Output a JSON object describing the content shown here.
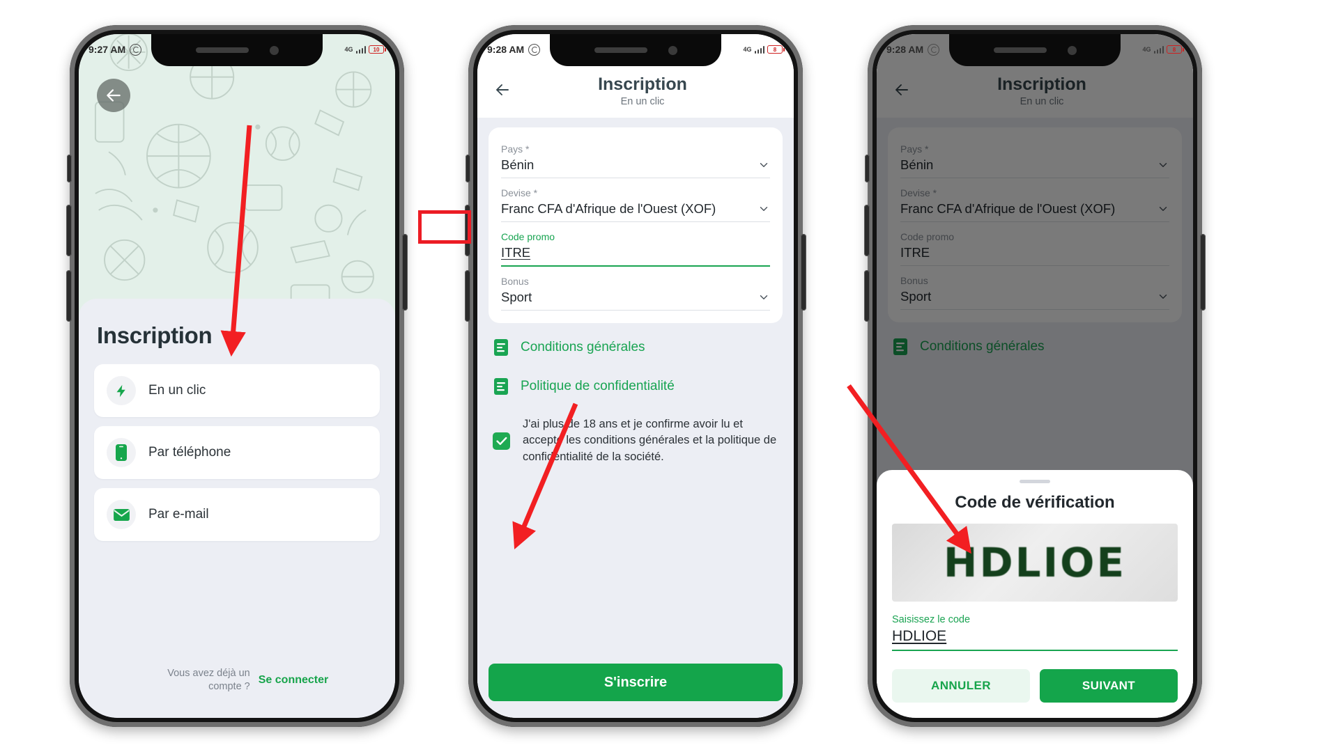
{
  "phones": [
    {
      "id": "phone-registration-methods",
      "statusbar": {
        "time": "9:27 AM",
        "whatsapp_icon": "whatsapp-icon",
        "network": "4G",
        "battery": "10"
      },
      "back_icon": "back-arrow-icon",
      "sheet_title": "Inscription",
      "options": [
        {
          "icon": "lightning-bolt-icon",
          "label": "En un clic"
        },
        {
          "icon": "phone-icon",
          "label": "Par téléphone"
        },
        {
          "icon": "envelope-icon",
          "label": "Par e-mail"
        }
      ],
      "footer": {
        "question": "Vous avez déjà un compte ?",
        "link": "Se connecter"
      }
    },
    {
      "id": "phone-registration-form",
      "statusbar": {
        "time": "9:28 AM",
        "whatsapp_icon": "whatsapp-icon",
        "network": "4G",
        "battery": "8"
      },
      "appbar": {
        "back_icon": "back-arrow-icon",
        "title": "Inscription",
        "subtitle": "En un clic"
      },
      "fields": [
        {
          "label": "Pays *",
          "value": "Bénin",
          "control": "dropdown",
          "focused": false
        },
        {
          "label": "Devise *",
          "value": "Franc CFA d'Afrique de l'Ouest (XOF)",
          "control": "dropdown",
          "focused": false
        },
        {
          "label": "Code promo",
          "value": "ITRE",
          "control": "text",
          "focused": true
        },
        {
          "label": "Bonus",
          "value": "Sport",
          "control": "dropdown",
          "focused": false
        }
      ],
      "links": [
        {
          "icon": "document-icon",
          "label": "Conditions générales"
        },
        {
          "icon": "document-icon",
          "label": "Politique de confidentialité"
        }
      ],
      "consent": {
        "checked": true,
        "text": "J'ai plus de 18 ans et je confirme avoir lu et accepté les conditions générales et la politique de confidentialité de la société."
      },
      "submit_label": "S'inscrire"
    },
    {
      "id": "phone-verification-modal",
      "statusbar": {
        "time": "9:28 AM",
        "whatsapp_icon": "whatsapp-icon",
        "network": "4G",
        "battery": "8"
      },
      "appbar": {
        "back_icon": "back-arrow-icon",
        "title": "Inscription",
        "subtitle": "En un clic"
      },
      "fields": [
        {
          "label": "Pays *",
          "value": "Bénin",
          "control": "dropdown",
          "focused": false
        },
        {
          "label": "Devise *",
          "value": "Franc CFA d'Afrique de l'Ouest (XOF)",
          "control": "dropdown",
          "focused": false
        },
        {
          "label": "Code promo",
          "value": "ITRE",
          "control": "text",
          "focused": false
        },
        {
          "label": "Bonus",
          "value": "Sport",
          "control": "dropdown",
          "focused": false
        }
      ],
      "links": [
        {
          "icon": "document-icon",
          "label": "Conditions générales"
        }
      ],
      "modal": {
        "title": "Code de vérification",
        "captcha_text": "HDLIOE",
        "input_label": "Saisissez le code",
        "input_value": "HDLIOE",
        "cancel_label": "ANNULER",
        "next_label": "SUIVANT"
      }
    }
  ],
  "colors": {
    "green": "#14a54b",
    "green_link": "#19a452",
    "hero_bg": "#e3f0e9",
    "screen_bg": "#eceef4",
    "annotation_red": "#ec1c24",
    "title_dark": "#263238"
  }
}
